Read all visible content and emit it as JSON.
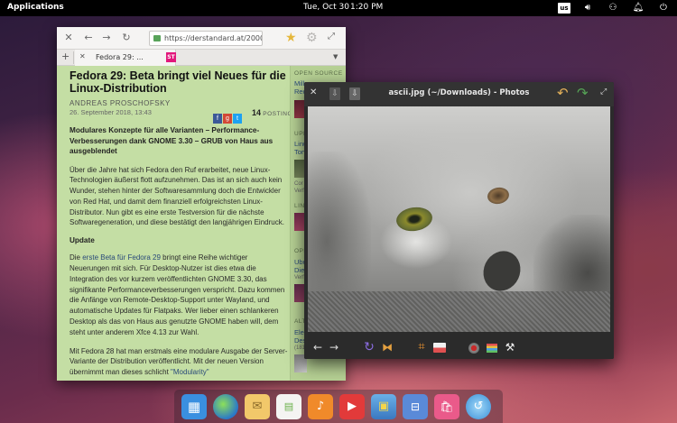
{
  "top_panel": {
    "applications_label": "Applications",
    "date": "Tue, Oct 30",
    "time": "1:20 PM",
    "keyboard_layout": "us",
    "indicators": [
      "volume-icon",
      "network-icon",
      "notifications-icon",
      "power-icon"
    ]
  },
  "browser": {
    "url": "https://derstandard.at/200008",
    "tab_title": "Fedora 29: ...",
    "tab_favicon": "ST",
    "article": {
      "headline": "Fedora 29: Beta bringt viel Neues für die Linux-Distribution",
      "author": "ANDREAS PROSCHOFSKY",
      "date": "26. September 2018, 13:43",
      "postings_count": "14",
      "postings_label": "POSTINGS",
      "lead": "Modulares Konzepte für alle Varianten – Performance-Verbesserungen dank GNOME 3.30 – GRUB von Haus aus ausgeblendet",
      "para1": "Über die Jahre hat sich Fedora den Ruf erarbeitet, neue Linux-Technologien äußerst flott aufzunehmen. Das ist an sich auch kein Wunder, stehen hinter der Softwaresammlung doch die Entwickler von Red Hat, und damit dem finanziell erfolgreichsten Linux-Distributor. Nun gibt es eine erste Testversion für die nächste Softwaregeneration, und diese bestätigt den langjährigen Eindruck.",
      "subheading": "Update",
      "para2_link": "erste Beta für Fedora 29",
      "para2_before": "Die ",
      "para2_after": " bringt eine Reihe wichtiger Neuerungen mit sich. Für Desktop-Nutzer ist dies etwa die Integration des vor kurzem veröffentlichten GNOME 3.30, das signifikante Performanceverbesserungen verspricht. Dazu kommen die Anfänge von Remote-Desktop-Support unter Wayland, und automatische Updates für Flatpaks. Wer lieber einen schlankeren Desktop als das von Haus aus genutzte GNOME haben will, dem steht unter anderem Xfce 4.13 zur Wahl.",
      "para3_before": "Mit Fedora 28 hat man erstmals eine modulare Ausgabe der Server-Variante der Distribution veröffentlicht. Mit der neuen Version übernimmt man dieses schlicht ",
      "para3_link": "\"Modularity\""
    },
    "sidebar": {
      "sec1": "OPEN SOURCE",
      "link1a": "Mill",
      "link1b": "Red",
      "sec2": "UPD",
      "link2a": "Linu",
      "link2b": "Torv",
      "small2a": "Cor",
      "small2b": "Verf",
      "sec3": "LINU",
      "sec4": "OPP",
      "link4a": "Ubu",
      "link4b": "Die",
      "small4a": "Verf",
      "sec5": "ALTE",
      "link5a": "Elen",
      "link5b": "Des",
      "small5a": "(181"
    }
  },
  "photos": {
    "title": "ascii.jpg (~/Downloads) - Photos"
  },
  "dock": {
    "apps": [
      "multitasking-view",
      "web-browser",
      "mail",
      "calendar",
      "music",
      "videos",
      "photos",
      "switchboard-settings",
      "appcenter",
      "system-updater"
    ]
  },
  "colors": {
    "panel_bg": "#000000",
    "article_bg": "#c4dea4",
    "photos_bg": "#2b2b2b",
    "undo_accent": "#e4b15a",
    "redo_accent": "#56a456"
  }
}
